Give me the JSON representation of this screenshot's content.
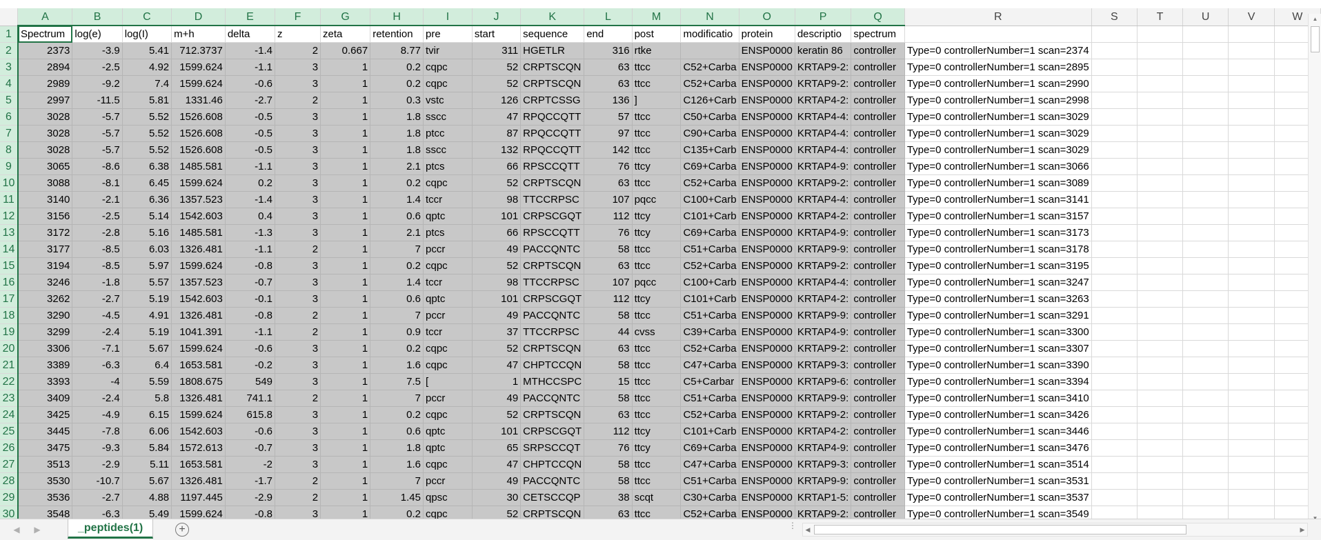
{
  "sheet": {
    "columns": [
      "A",
      "B",
      "C",
      "D",
      "E",
      "F",
      "G",
      "H",
      "I",
      "J",
      "K",
      "L",
      "M",
      "N",
      "O",
      "P",
      "Q",
      "R",
      "S",
      "T",
      "U",
      "V",
      "W"
    ],
    "header_row": [
      "Spectrum",
      "log(e)",
      "log(I)",
      "m+h",
      "delta",
      "z",
      "zeta",
      "retention",
      "pre",
      "start",
      "sequence",
      "end",
      "post",
      "modificatio",
      "protein",
      "descriptio",
      "spectrum"
    ],
    "rows": [
      [
        "2373",
        "-3.9",
        "5.41",
        "712.3737",
        "-1.4",
        "2",
        "0.667",
        "8.77",
        "tvir",
        "311",
        "HGETLR",
        "316",
        "rtke",
        "",
        "ENSP0000",
        "keratin 86",
        "controller",
        "Type=0 controllerNumber=1 scan=2374"
      ],
      [
        "2894",
        "-2.5",
        "4.92",
        "1599.624",
        "-1.1",
        "3",
        "1",
        "0.2",
        "cqpc",
        "52",
        "CRPTSCQN",
        "63",
        "ttcc",
        "C52+Carba",
        "ENSP0000",
        "KRTAP9-2:",
        "controller",
        "Type=0 controllerNumber=1 scan=2895"
      ],
      [
        "2989",
        "-9.2",
        "7.4",
        "1599.624",
        "-0.6",
        "3",
        "1",
        "0.2",
        "cqpc",
        "52",
        "CRPTSCQN",
        "63",
        "ttcc",
        "C52+Carba",
        "ENSP0000",
        "KRTAP9-2:",
        "controller",
        "Type=0 controllerNumber=1 scan=2990"
      ],
      [
        "2997",
        "-11.5",
        "5.81",
        "1331.46",
        "-2.7",
        "2",
        "1",
        "0.3",
        "vstc",
        "126",
        "CRPTCSSG",
        "136",
        "]",
        "C126+Carb",
        "ENSP0000",
        "KRTAP4-2:",
        "controller",
        "Type=0 controllerNumber=1 scan=2998"
      ],
      [
        "3028",
        "-5.7",
        "5.52",
        "1526.608",
        "-0.5",
        "3",
        "1",
        "1.8",
        "sscc",
        "47",
        "RPQCCQTT",
        "57",
        "ttcc",
        "C50+Carba",
        "ENSP0000",
        "KRTAP4-4:",
        "controller",
        "Type=0 controllerNumber=1 scan=3029"
      ],
      [
        "3028",
        "-5.7",
        "5.52",
        "1526.608",
        "-0.5",
        "3",
        "1",
        "1.8",
        "ptcc",
        "87",
        "RPQCCQTT",
        "97",
        "ttcc",
        "C90+Carba",
        "ENSP0000",
        "KRTAP4-4:",
        "controller",
        "Type=0 controllerNumber=1 scan=3029"
      ],
      [
        "3028",
        "-5.7",
        "5.52",
        "1526.608",
        "-0.5",
        "3",
        "1",
        "1.8",
        "sscc",
        "132",
        "RPQCCQTT",
        "142",
        "ttcc",
        "C135+Carb",
        "ENSP0000",
        "KRTAP4-4:",
        "controller",
        "Type=0 controllerNumber=1 scan=3029"
      ],
      [
        "3065",
        "-8.6",
        "6.38",
        "1485.581",
        "-1.1",
        "3",
        "1",
        "2.1",
        "ptcs",
        "66",
        "RPSCCQTT",
        "76",
        "ttcy",
        "C69+Carba",
        "ENSP0000",
        "KRTAP4-9:",
        "controller",
        "Type=0 controllerNumber=1 scan=3066"
      ],
      [
        "3088",
        "-8.1",
        "6.45",
        "1599.624",
        "0.2",
        "3",
        "1",
        "0.2",
        "cqpc",
        "52",
        "CRPTSCQN",
        "63",
        "ttcc",
        "C52+Carba",
        "ENSP0000",
        "KRTAP9-2:",
        "controller",
        "Type=0 controllerNumber=1 scan=3089"
      ],
      [
        "3140",
        "-2.1",
        "6.36",
        "1357.523",
        "-1.4",
        "3",
        "1",
        "1.4",
        "tccr",
        "98",
        "TTCCRPSC",
        "107",
        "pqcc",
        "C100+Carb",
        "ENSP0000",
        "KRTAP4-4:",
        "controller",
        "Type=0 controllerNumber=1 scan=3141"
      ],
      [
        "3156",
        "-2.5",
        "5.14",
        "1542.603",
        "0.4",
        "3",
        "1",
        "0.6",
        "qptc",
        "101",
        "CRPSCGQT",
        "112",
        "ttcy",
        "C101+Carb",
        "ENSP0000",
        "KRTAP4-2:",
        "controller",
        "Type=0 controllerNumber=1 scan=3157"
      ],
      [
        "3172",
        "-2.8",
        "5.16",
        "1485.581",
        "-1.3",
        "3",
        "1",
        "2.1",
        "ptcs",
        "66",
        "RPSCCQTT",
        "76",
        "ttcy",
        "C69+Carba",
        "ENSP0000",
        "KRTAP4-9:",
        "controller",
        "Type=0 controllerNumber=1 scan=3173"
      ],
      [
        "3177",
        "-8.5",
        "6.03",
        "1326.481",
        "-1.1",
        "2",
        "1",
        "7",
        "pccr",
        "49",
        "PACCQNTC",
        "58",
        "ttcc",
        "C51+Carba",
        "ENSP0000",
        "KRTAP9-9:",
        "controller",
        "Type=0 controllerNumber=1 scan=3178"
      ],
      [
        "3194",
        "-8.5",
        "5.97",
        "1599.624",
        "-0.8",
        "3",
        "1",
        "0.2",
        "cqpc",
        "52",
        "CRPTSCQN",
        "63",
        "ttcc",
        "C52+Carba",
        "ENSP0000",
        "KRTAP9-2:",
        "controller",
        "Type=0 controllerNumber=1 scan=3195"
      ],
      [
        "3246",
        "-1.8",
        "5.57",
        "1357.523",
        "-0.7",
        "3",
        "1",
        "1.4",
        "tccr",
        "98",
        "TTCCRPSC",
        "107",
        "pqcc",
        "C100+Carb",
        "ENSP0000",
        "KRTAP4-4:",
        "controller",
        "Type=0 controllerNumber=1 scan=3247"
      ],
      [
        "3262",
        "-2.7",
        "5.19",
        "1542.603",
        "-0.1",
        "3",
        "1",
        "0.6",
        "qptc",
        "101",
        "CRPSCGQT",
        "112",
        "ttcy",
        "C101+Carb",
        "ENSP0000",
        "KRTAP4-2:",
        "controller",
        "Type=0 controllerNumber=1 scan=3263"
      ],
      [
        "3290",
        "-4.5",
        "4.91",
        "1326.481",
        "-0.8",
        "2",
        "1",
        "7",
        "pccr",
        "49",
        "PACCQNTC",
        "58",
        "ttcc",
        "C51+Carba",
        "ENSP0000",
        "KRTAP9-9:",
        "controller",
        "Type=0 controllerNumber=1 scan=3291"
      ],
      [
        "3299",
        "-2.4",
        "5.19",
        "1041.391",
        "-1.1",
        "2",
        "1",
        "0.9",
        "tccr",
        "37",
        "TTCCRPSC",
        "44",
        "cvss",
        "C39+Carba",
        "ENSP0000",
        "KRTAP4-9:",
        "controller",
        "Type=0 controllerNumber=1 scan=3300"
      ],
      [
        "3306",
        "-7.1",
        "5.67",
        "1599.624",
        "-0.6",
        "3",
        "1",
        "0.2",
        "cqpc",
        "52",
        "CRPTSCQN",
        "63",
        "ttcc",
        "C52+Carba",
        "ENSP0000",
        "KRTAP9-2:",
        "controller",
        "Type=0 controllerNumber=1 scan=3307"
      ],
      [
        "3389",
        "-6.3",
        "6.4",
        "1653.581",
        "-0.2",
        "3",
        "1",
        "1.6",
        "cqpc",
        "47",
        "CHPTCCQN",
        "58",
        "ttcc",
        "C47+Carba",
        "ENSP0000",
        "KRTAP9-3:",
        "controller",
        "Type=0 controllerNumber=1 scan=3390"
      ],
      [
        "3393",
        "-4",
        "5.59",
        "1808.675",
        "549",
        "3",
        "1",
        "7.5",
        "[",
        "1",
        "MTHCCSPC",
        "15",
        "ttcc",
        "C5+Carbar",
        "ENSP0000",
        "KRTAP9-6:",
        "controller",
        "Type=0 controllerNumber=1 scan=3394"
      ],
      [
        "3409",
        "-2.4",
        "5.8",
        "1326.481",
        "741.1",
        "2",
        "1",
        "7",
        "pccr",
        "49",
        "PACCQNTC",
        "58",
        "ttcc",
        "C51+Carba",
        "ENSP0000",
        "KRTAP9-9:",
        "controller",
        "Type=0 controllerNumber=1 scan=3410"
      ],
      [
        "3425",
        "-4.9",
        "6.15",
        "1599.624",
        "615.8",
        "3",
        "1",
        "0.2",
        "cqpc",
        "52",
        "CRPTSCQN",
        "63",
        "ttcc",
        "C52+Carba",
        "ENSP0000",
        "KRTAP9-2:",
        "controller",
        "Type=0 controllerNumber=1 scan=3426"
      ],
      [
        "3445",
        "-7.8",
        "6.06",
        "1542.603",
        "-0.6",
        "3",
        "1",
        "0.6",
        "qptc",
        "101",
        "CRPSCGQT",
        "112",
        "ttcy",
        "C101+Carb",
        "ENSP0000",
        "KRTAP4-2:",
        "controller",
        "Type=0 controllerNumber=1 scan=3446"
      ],
      [
        "3475",
        "-9.3",
        "5.84",
        "1572.613",
        "-0.7",
        "3",
        "1",
        "1.8",
        "qptc",
        "65",
        "SRPSCCQT",
        "76",
        "ttcy",
        "C69+Carba",
        "ENSP0000",
        "KRTAP4-9:",
        "controller",
        "Type=0 controllerNumber=1 scan=3476"
      ],
      [
        "3513",
        "-2.9",
        "5.11",
        "1653.581",
        "-2",
        "3",
        "1",
        "1.6",
        "cqpc",
        "47",
        "CHPTCCQN",
        "58",
        "ttcc",
        "C47+Carba",
        "ENSP0000",
        "KRTAP9-3:",
        "controller",
        "Type=0 controllerNumber=1 scan=3514"
      ],
      [
        "3530",
        "-10.7",
        "5.67",
        "1326.481",
        "-1.7",
        "2",
        "1",
        "7",
        "pccr",
        "49",
        "PACCQNTC",
        "58",
        "ttcc",
        "C51+Carba",
        "ENSP0000",
        "KRTAP9-9:",
        "controller",
        "Type=0 controllerNumber=1 scan=3531"
      ],
      [
        "3536",
        "-2.7",
        "4.88",
        "1197.445",
        "-2.9",
        "2",
        "1",
        "1.45",
        "qpsc",
        "30",
        "CETSCCQP",
        "38",
        "scqt",
        "C30+Carba",
        "ENSP0000",
        "KRTAP1-5:",
        "controller",
        "Type=0 controllerNumber=1 scan=3537"
      ],
      [
        "3548",
        "-6.3",
        "5.49",
        "1599.624",
        "-0.8",
        "3",
        "1",
        "0.2",
        "cqpc",
        "52",
        "CRPTSCQN",
        "63",
        "ttcc",
        "C52+Carba",
        "ENSP0000",
        "KRTAP9-2:",
        "controller",
        "Type=0 controllerNumber=1 scan=3549"
      ]
    ]
  },
  "tabs": {
    "active_sheet": "_peptides(1)",
    "add_sheet_symbol": "+",
    "prev_symbol": "◀",
    "next_symbol": "▶",
    "split_symbol": "⋮"
  },
  "scroll": {
    "up_symbol": "▲",
    "down_symbol": "▼",
    "left_symbol": "◀",
    "right_symbol": "▶"
  },
  "colors": {
    "selection_fill": "#c8c8c8",
    "selected_header": "#d2eddc",
    "accent": "#217346"
  }
}
